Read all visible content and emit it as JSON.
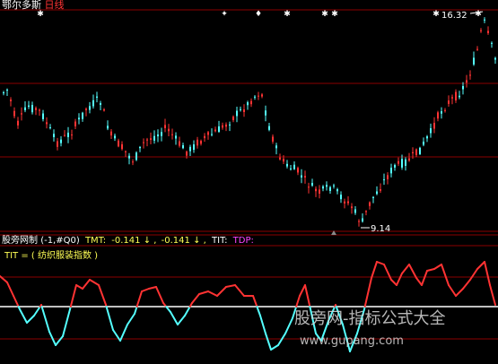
{
  "top_panel": {
    "stock_name": "鄂尔多斯",
    "period": "日线",
    "high_label": "16.32",
    "low_label": "9.14",
    "signal_marks": [
      "✱",
      "✦",
      "♦",
      "✱",
      "✱",
      "✱",
      "✱",
      "✱"
    ]
  },
  "bottom_panel": {
    "indicator_name": "股旁网制",
    "params": "(-1,#Q0)",
    "tmt_label": "TMT:",
    "tmt_value": "-0.141",
    "tmt_arrow": "↓",
    "second_value": "-0.141",
    "second_arrow": "↓",
    "tit_label": "TIT:",
    "tdp_label": "TDP:",
    "formula_text": "TIT = ( 纺织服装指数 )"
  },
  "watermark": {
    "line1": "股旁网-指标公式大全",
    "line2": "www.gupang.com"
  },
  "colors": {
    "up": "#ff3333",
    "down": "#54ffff",
    "grid": "#8b0000",
    "baseline": "#ffffff",
    "title_name": "#ffffff",
    "title_period": "#ff3333",
    "tmt": "#ffff55",
    "tit": "#ffffff",
    "tdp": "#ff44ff"
  }
}
